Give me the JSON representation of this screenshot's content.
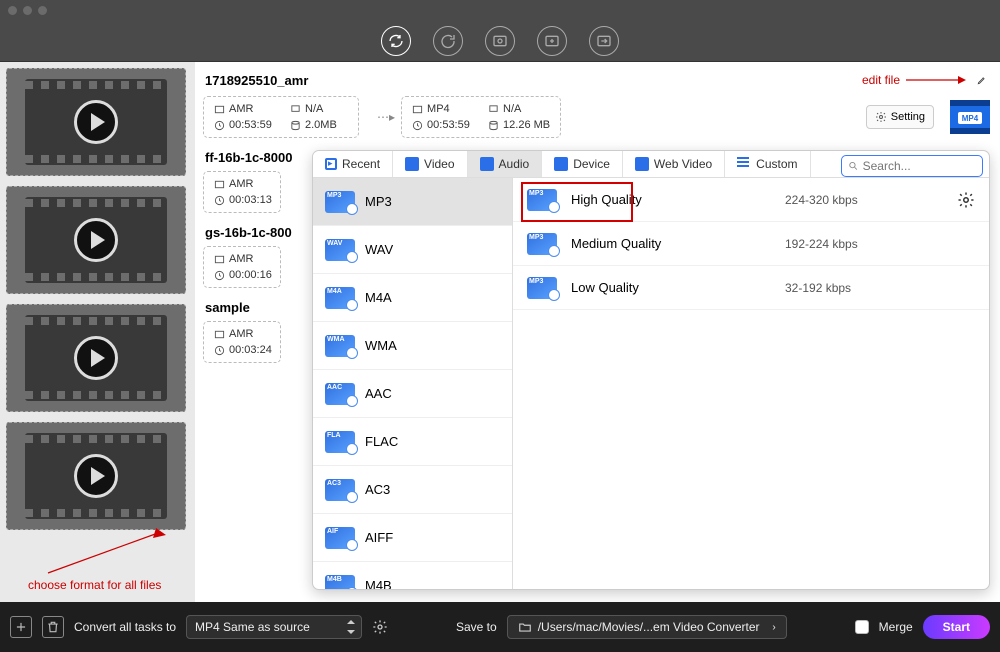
{
  "toolbar": {
    "buttons": [
      "sync-icon",
      "refresh-sync-icon",
      "film-settings-icon",
      "film-plus-icon",
      "film-convert-icon"
    ]
  },
  "tasks": [
    {
      "title": "1718925510_amr",
      "source": {
        "codec": "AMR",
        "duration": "00:53:59",
        "resolution": "N/A",
        "size": "2.0MB"
      },
      "target": {
        "codec": "MP4",
        "duration": "00:53:59",
        "resolution": "N/A",
        "size": "12.26 MB"
      },
      "setting_label": "Setting"
    },
    {
      "title": "ff-16b-1c-8000",
      "source": {
        "codec": "AMR",
        "duration": "00:03:13"
      }
    },
    {
      "title": "gs-16b-1c-800",
      "source": {
        "codec": "AMR",
        "duration": "00:00:16"
      }
    },
    {
      "title": "sample",
      "source": {
        "codec": "AMR",
        "duration": "00:03:24"
      }
    }
  ],
  "annotations": {
    "edit_file": "edit file",
    "choose_format": "choose format for all files"
  },
  "popover": {
    "tabs": [
      "Recent",
      "Video",
      "Audio",
      "Device",
      "Web Video",
      "Custom"
    ],
    "active_tab": "Audio",
    "search_placeholder": "Search...",
    "formats": [
      "MP3",
      "WAV",
      "M4A",
      "WMA",
      "AAC",
      "FLAC",
      "AC3",
      "AIFF",
      "M4B"
    ],
    "selected_format": "MP3",
    "qualities": [
      {
        "name": "High Quality",
        "rate": "224-320 kbps",
        "highlight": true,
        "gear": true
      },
      {
        "name": "Medium Quality",
        "rate": "192-224 kbps"
      },
      {
        "name": "Low Quality",
        "rate": "32-192 kbps"
      }
    ]
  },
  "bottombar": {
    "convert_label": "Convert all tasks to",
    "convert_value": "MP4 Same as source",
    "save_label": "Save to",
    "save_path": "/Users/mac/Movies/...em Video Converter",
    "merge_label": "Merge",
    "start_label": "Start"
  }
}
